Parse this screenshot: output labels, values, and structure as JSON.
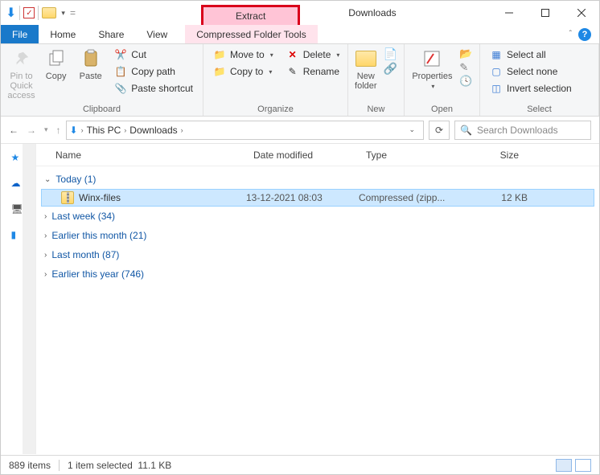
{
  "window": {
    "title": "Downloads",
    "context_tab": "Extract",
    "context_label": "Compressed Folder Tools"
  },
  "tabs": {
    "file": "File",
    "home": "Home",
    "share": "Share",
    "view": "View"
  },
  "ribbon": {
    "clipboard": {
      "label": "Clipboard",
      "pin": "Pin to Quick access",
      "copy": "Copy",
      "paste": "Paste",
      "cut": "Cut",
      "copy_path": "Copy path",
      "paste_shortcut": "Paste shortcut"
    },
    "organize": {
      "label": "Organize",
      "move_to": "Move to",
      "copy_to": "Copy to",
      "delete": "Delete",
      "rename": "Rename"
    },
    "new": {
      "label": "New",
      "new_folder": "New folder"
    },
    "open": {
      "label": "Open",
      "properties": "Properties"
    },
    "select": {
      "label": "Select",
      "select_all": "Select all",
      "select_none": "Select none",
      "invert": "Invert selection"
    }
  },
  "breadcrumbs": [
    "This PC",
    "Downloads"
  ],
  "search_placeholder": "Search Downloads",
  "columns": {
    "name": "Name",
    "date": "Date modified",
    "type": "Type",
    "size": "Size"
  },
  "groups": [
    {
      "label": "Today (1)",
      "expanded": true,
      "items": [
        {
          "name": "Winx-files",
          "date": "13-12-2021 08:03",
          "type": "Compressed (zipp...",
          "size": "12 KB"
        }
      ]
    },
    {
      "label": "Last week (34)",
      "expanded": false
    },
    {
      "label": "Earlier this month (21)",
      "expanded": false
    },
    {
      "label": "Last month (87)",
      "expanded": false
    },
    {
      "label": "Earlier this year (746)",
      "expanded": false
    }
  ],
  "status": {
    "items": "889 items",
    "selected": "1 item selected",
    "size": "11.1 KB"
  }
}
